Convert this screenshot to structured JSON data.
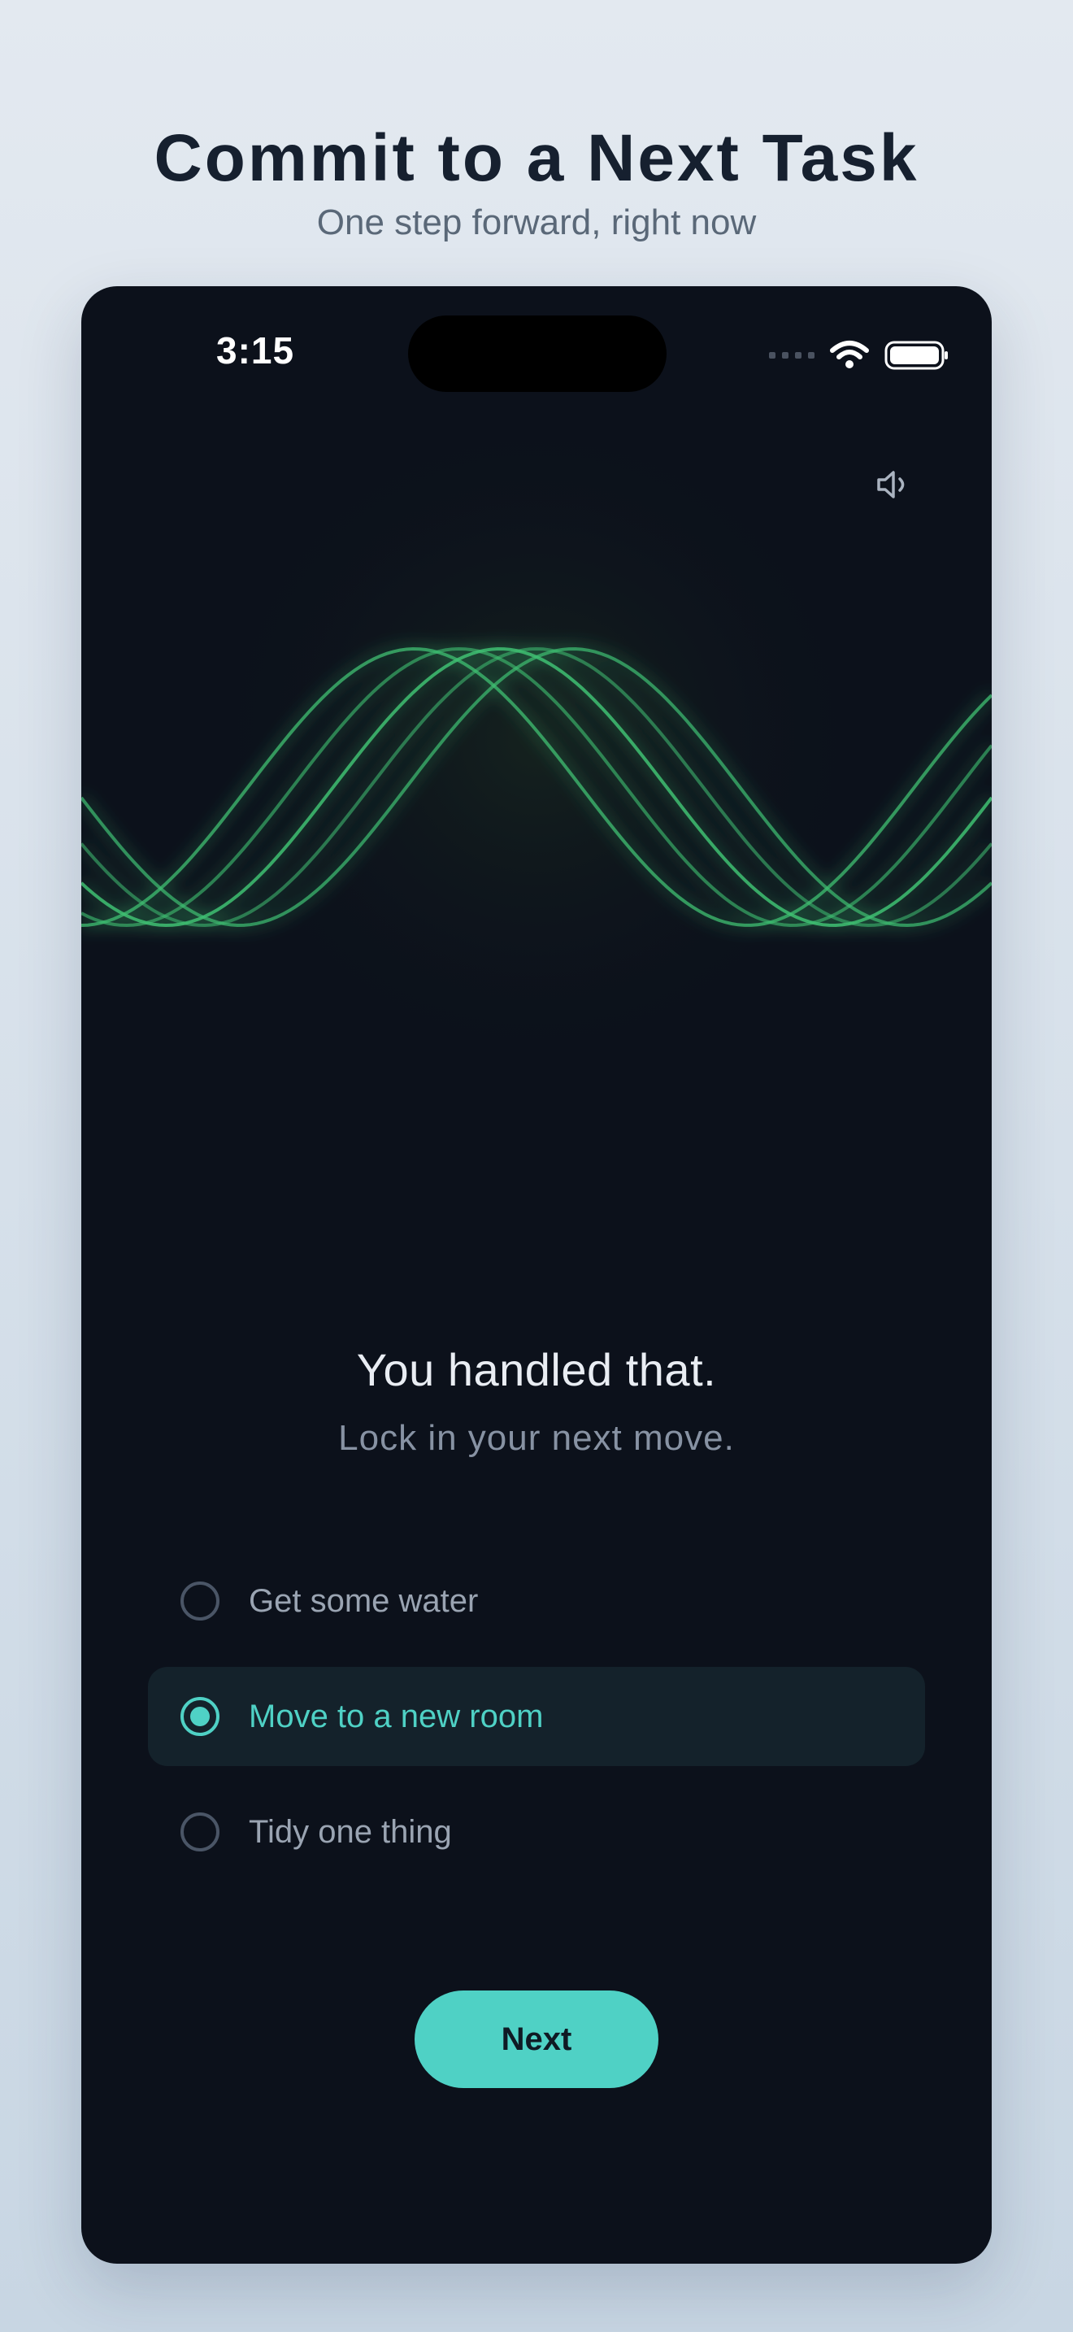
{
  "header": {
    "title": "Commit to a Next Task",
    "subtitle": "One step forward, right now"
  },
  "status_bar": {
    "time": "3:15",
    "icons": [
      "signal-dots-icon",
      "wifi-icon",
      "battery-icon"
    ]
  },
  "sound_toggle": {
    "icon": "speaker-icon"
  },
  "visual": {
    "type": "sine-wave-animation",
    "color": "#3fbf72"
  },
  "main": {
    "headline": "You handled that.",
    "subline": "Lock in your next move."
  },
  "options": [
    {
      "label": "Get some water",
      "selected": false
    },
    {
      "label": "Move to a new room",
      "selected": true
    },
    {
      "label": "Tidy one thing",
      "selected": false
    }
  ],
  "next_button": {
    "label": "Next"
  },
  "colors": {
    "background": "#0c111b",
    "accent": "#4fd1c5",
    "wave": "#3fbf72",
    "selected_row": "#14222b",
    "text_primary": "#e9edf3",
    "text_secondary": "#8792a3"
  }
}
